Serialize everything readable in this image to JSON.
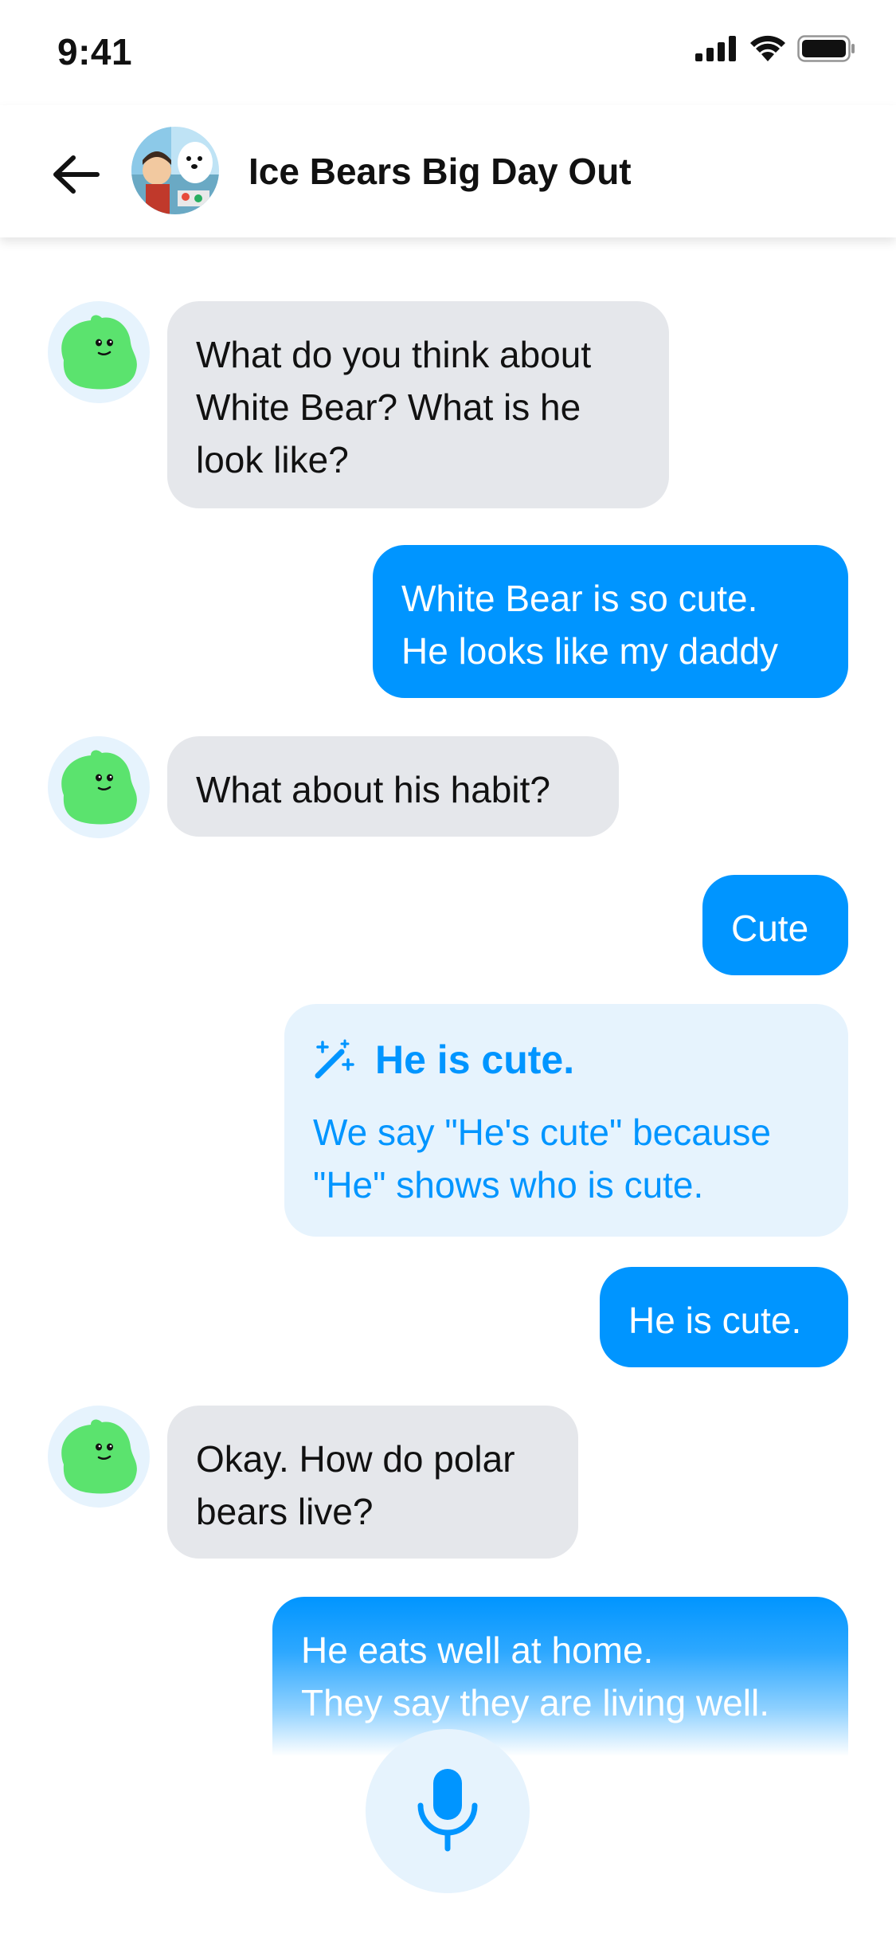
{
  "status_bar": {
    "time": "9:41",
    "icons": [
      "signal-icon",
      "wifi-icon",
      "battery-icon"
    ]
  },
  "header": {
    "title": "Ice Bears Big Day Out",
    "back_icon": "arrow-left-icon",
    "avatar": "episode-thumbnail"
  },
  "messages": [
    {
      "sender": "bot",
      "lines": [
        "What do you think about",
        "White Bear? What is he",
        "look like?"
      ]
    },
    {
      "sender": "user",
      "lines": [
        "White Bear is so cute.",
        "He looks like my daddy"
      ]
    },
    {
      "sender": "bot",
      "lines": [
        "What about his habit?"
      ]
    },
    {
      "sender": "user",
      "lines": [
        "Cute"
      ]
    },
    {
      "sender": "correction",
      "title": "He is cute.",
      "icon": "magic-wand-icon",
      "lines": [
        "We say \"He's cute\" because",
        "\"He\" shows who is cute."
      ]
    },
    {
      "sender": "user",
      "lines": [
        "He is cute."
      ]
    },
    {
      "sender": "bot",
      "lines": [
        "Okay. How do polar",
        "bears live?"
      ]
    },
    {
      "sender": "user-transcribing",
      "lines": [
        "He eats well at home.",
        "They say they are living well."
      ]
    }
  ],
  "mic": {
    "icon": "microphone-icon"
  },
  "colors": {
    "accent": "#0095ff",
    "bot_bubble": "#e5e7eb",
    "correction_bg": "#e6f3fd",
    "bot_avatar": "#5be36e"
  }
}
